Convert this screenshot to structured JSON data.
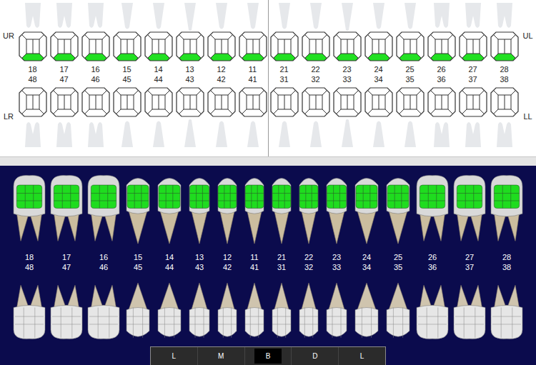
{
  "quadrant_labels": {
    "upper_right": "UR",
    "upper_left": "UL",
    "lower_right": "LR",
    "lower_left": "LL"
  },
  "teeth": {
    "upper": [
      {
        "number": "18",
        "filled": true,
        "kind": "molar"
      },
      {
        "number": "17",
        "filled": true,
        "kind": "molar"
      },
      {
        "number": "16",
        "filled": true,
        "kind": "molar"
      },
      {
        "number": "15",
        "filled": true,
        "kind": "premolar"
      },
      {
        "number": "14",
        "filled": true,
        "kind": "premolar"
      },
      {
        "number": "13",
        "filled": true,
        "kind": "canine"
      },
      {
        "number": "12",
        "filled": true,
        "kind": "incisor"
      },
      {
        "number": "11",
        "filled": true,
        "kind": "incisor"
      },
      {
        "number": "21",
        "filled": true,
        "kind": "incisor"
      },
      {
        "number": "22",
        "filled": true,
        "kind": "incisor"
      },
      {
        "number": "23",
        "filled": true,
        "kind": "canine"
      },
      {
        "number": "24",
        "filled": true,
        "kind": "premolar"
      },
      {
        "number": "25",
        "filled": true,
        "kind": "premolar"
      },
      {
        "number": "26",
        "filled": true,
        "kind": "molar"
      },
      {
        "number": "27",
        "filled": true,
        "kind": "molar"
      },
      {
        "number": "28",
        "filled": true,
        "kind": "molar"
      }
    ],
    "lower": [
      {
        "number": "48",
        "filled": false,
        "kind": "molar"
      },
      {
        "number": "47",
        "filled": false,
        "kind": "molar"
      },
      {
        "number": "46",
        "filled": false,
        "kind": "molar"
      },
      {
        "number": "45",
        "filled": false,
        "kind": "premolar"
      },
      {
        "number": "44",
        "filled": false,
        "kind": "premolar"
      },
      {
        "number": "43",
        "filled": false,
        "kind": "canine"
      },
      {
        "number": "42",
        "filled": false,
        "kind": "incisor"
      },
      {
        "number": "41",
        "filled": false,
        "kind": "incisor"
      },
      {
        "number": "31",
        "filled": false,
        "kind": "incisor"
      },
      {
        "number": "32",
        "filled": false,
        "kind": "incisor"
      },
      {
        "number": "33",
        "filled": false,
        "kind": "canine"
      },
      {
        "number": "34",
        "filled": false,
        "kind": "premolar"
      },
      {
        "number": "35",
        "filled": false,
        "kind": "premolar"
      },
      {
        "number": "36",
        "filled": false,
        "kind": "molar"
      },
      {
        "number": "37",
        "filled": false,
        "kind": "molar"
      },
      {
        "number": "38",
        "filled": false,
        "kind": "molar"
      }
    ]
  },
  "surface_toolbar": [
    {
      "label": "L",
      "selected": false
    },
    {
      "label": "M",
      "selected": false
    },
    {
      "label": "B",
      "selected": true
    },
    {
      "label": "D",
      "selected": false
    },
    {
      "label": "L",
      "selected": false
    }
  ]
}
